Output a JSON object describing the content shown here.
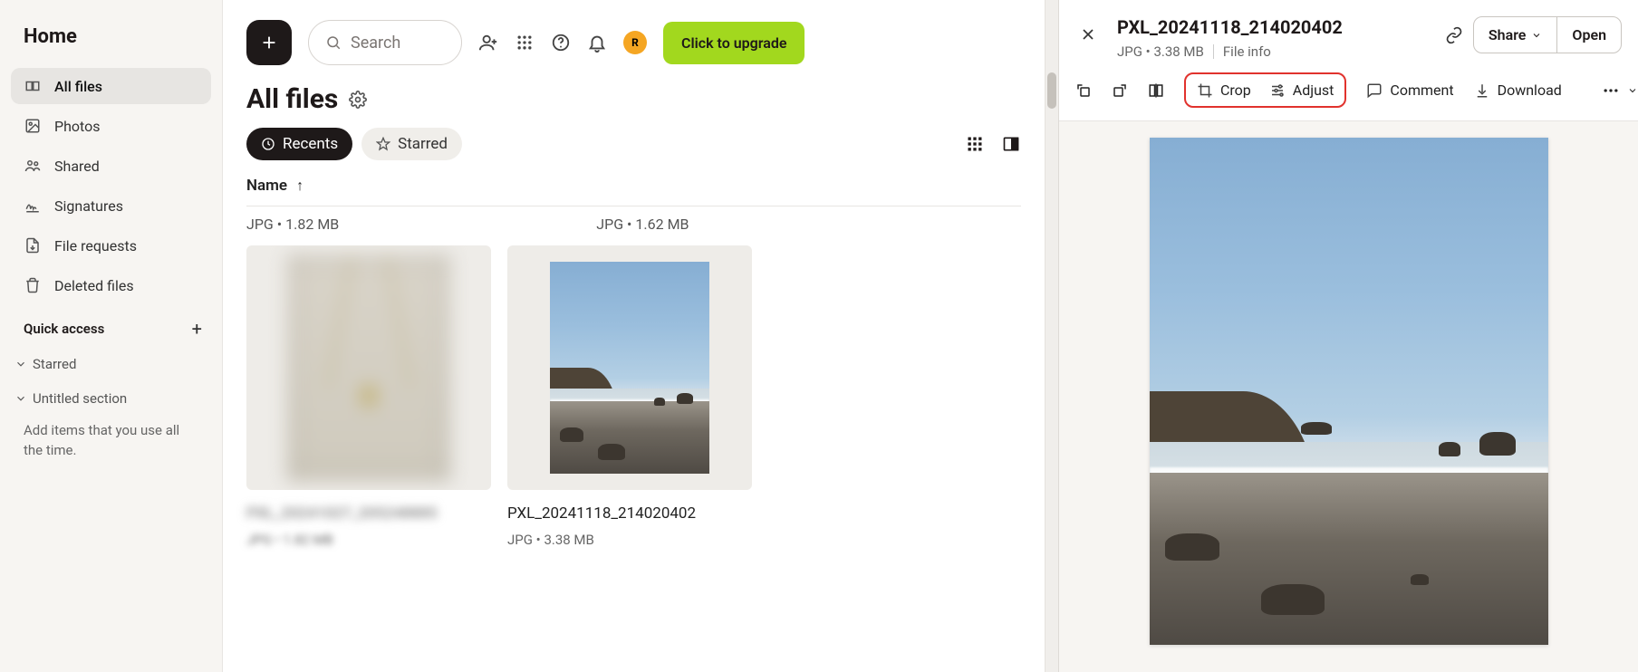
{
  "sidebar": {
    "home": "Home",
    "items": [
      {
        "label": "All files"
      },
      {
        "label": "Photos"
      },
      {
        "label": "Shared"
      },
      {
        "label": "Signatures"
      },
      {
        "label": "File requests"
      },
      {
        "label": "Deleted files"
      }
    ],
    "quick_access": "Quick access",
    "starred": "Starred",
    "untitled": "Untitled section",
    "hint": "Add items that you use all the time."
  },
  "topbar": {
    "search_placeholder": "Search",
    "avatar_initial": "R",
    "upgrade": "Click to upgrade"
  },
  "page_title": "All files",
  "chips": {
    "recents": "Recents",
    "starred": "Starred"
  },
  "table": {
    "name_col": "Name"
  },
  "meta_top": {
    "a": "JPG • 1.82 MB",
    "b": "JPG • 1.62 MB"
  },
  "files": [
    {
      "name": "PXL_20241027_205248885",
      "meta": "JPG • 1.82 MB"
    },
    {
      "name": "PXL_20241118_214020402",
      "meta": "JPG • 3.38 MB"
    }
  ],
  "panel": {
    "title": "PXL_20241118_214020402",
    "sub_meta": "JPG • 3.38 MB",
    "file_info": "File info",
    "share": "Share",
    "open": "Open",
    "toolbar": {
      "crop": "Crop",
      "adjust": "Adjust",
      "comment": "Comment",
      "download": "Download"
    }
  }
}
